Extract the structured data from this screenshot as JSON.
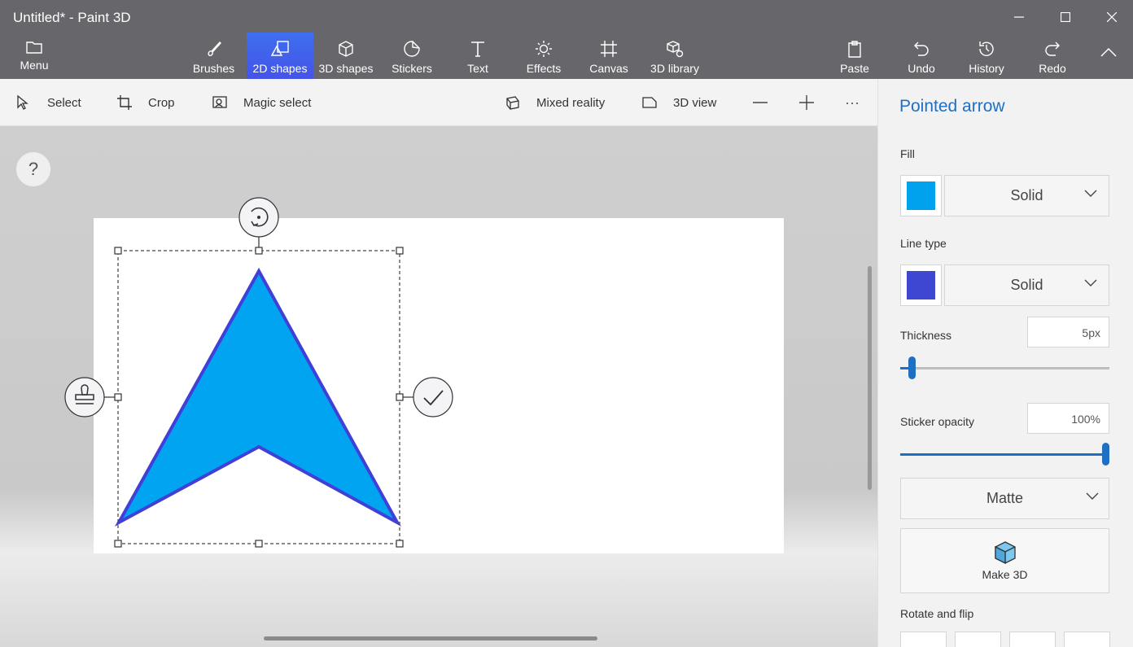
{
  "window": {
    "title": "Untitled* - Paint 3D"
  },
  "ribbon": {
    "menu": {
      "label": "Menu",
      "icon": "folder-icon"
    },
    "tabs": [
      {
        "label": "Brushes",
        "icon": "brush-icon",
        "active": false
      },
      {
        "label": "2D shapes",
        "icon": "2d-shapes-icon",
        "active": true
      },
      {
        "label": "3D shapes",
        "icon": "cube-icon",
        "active": false
      },
      {
        "label": "Stickers",
        "icon": "sticker-icon",
        "active": false
      },
      {
        "label": "Text",
        "icon": "text-icon",
        "active": false
      },
      {
        "label": "Effects",
        "icon": "sun-icon",
        "active": false
      },
      {
        "label": "Canvas",
        "icon": "canvas-icon",
        "active": false
      },
      {
        "label": "3D library",
        "icon": "3d-library-icon",
        "active": false
      }
    ],
    "actions": [
      {
        "label": "Paste",
        "icon": "clipboard-icon"
      },
      {
        "label": "Undo",
        "icon": "undo-icon"
      },
      {
        "label": "History",
        "icon": "history-icon"
      },
      {
        "label": "Redo",
        "icon": "redo-icon"
      }
    ]
  },
  "toolbar": {
    "select": "Select",
    "crop": "Crop",
    "magic_select": "Magic select",
    "mixed_reality": "Mixed reality",
    "view_3d": "3D view",
    "more": "···"
  },
  "canvas": {
    "help": "?",
    "colors": {
      "fill": "#00a4f0",
      "stroke": "#4040d8",
      "paper": "#ffffff"
    }
  },
  "panel": {
    "title": "Pointed arrow",
    "fill_label": "Fill",
    "fill_color": "#00a2ee",
    "fill_type": "Solid",
    "line_type_label": "Line type",
    "line_color": "#3d47d1",
    "line_type": "Solid",
    "thickness_label": "Thickness",
    "thickness_value": "5px",
    "thickness_fraction": 0.04,
    "opacity_label": "Sticker opacity",
    "opacity_value": "100%",
    "opacity_fraction": 1.0,
    "finish": "Matte",
    "make3d_label": "Make 3D",
    "rotate_flip_label": "Rotate and flip"
  },
  "accent_color": "#1f6fc2"
}
